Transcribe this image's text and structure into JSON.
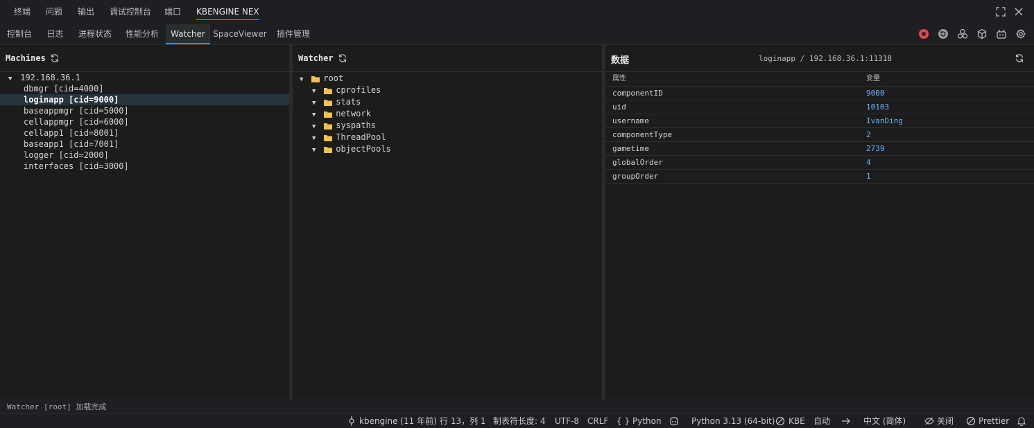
{
  "panel_tabs": [
    "终端",
    "问题",
    "输出",
    "调试控制台",
    "端口",
    "KBENGINE NEX"
  ],
  "sub_tabs": [
    "控制台",
    "日志",
    "进程状态",
    "性能分析",
    "Watcher",
    "SpaceViewer",
    "插件管理"
  ],
  "accent": "#3794ff",
  "toolbar_icons": [
    "stop-icon",
    "restart-icon",
    "cluster-icon",
    "cube-icon",
    "robot-icon",
    "gear-icon"
  ],
  "machines": {
    "title": "Machines",
    "host": "192.168.36.1",
    "components": [
      "dbmgr [cid=4000]",
      "loginapp [cid=9000]",
      "baseappmgr [cid=5000]",
      "cellappmgr [cid=6000]",
      "cellapp1 [cid=8001]",
      "baseapp1 [cid=7001]",
      "logger [cid=2000]",
      "interfaces [cid=3000]"
    ],
    "selected": "loginapp [cid=9000]"
  },
  "watcher": {
    "title": "Watcher",
    "root": "root",
    "children": [
      "cprofiles",
      "stats",
      "network",
      "syspaths",
      "ThreadPool",
      "objectPools"
    ]
  },
  "data": {
    "title": "数据",
    "target": "loginapp / 192.168.36.1:11318",
    "col_property": "属性",
    "col_value": "变量",
    "rows": [
      {
        "key": "componentID",
        "value": "9000"
      },
      {
        "key": "uid",
        "value": "10103"
      },
      {
        "key": "username",
        "value": "IvanDing"
      },
      {
        "key": "componentType",
        "value": "2"
      },
      {
        "key": "gametime",
        "value": "2739"
      },
      {
        "key": "globalOrder",
        "value": "4"
      },
      {
        "key": "groupOrder",
        "value": "1"
      }
    ]
  },
  "output_line": "Watcher [root] 加载完成",
  "status": {
    "git": "kbengine (11 年前)",
    "position": "行 13，列 1",
    "tab_size": "制表符长度: 4",
    "encoding": "UTF-8",
    "eol": "CRLF",
    "language": "Python",
    "interpreter": "Python 3.13 (64-bit)",
    "kbe": "KBE",
    "auto": "自动",
    "locale": "中文 (简体)",
    "close": "关闭",
    "prettier": "Prettier"
  }
}
